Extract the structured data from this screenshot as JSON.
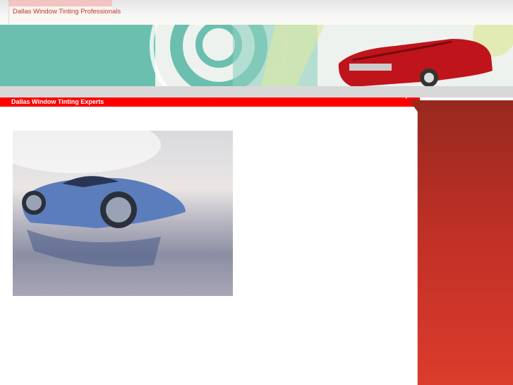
{
  "header": {
    "site_title": "Dallas Window Tinting Professionals"
  },
  "nav": {
    "tagline": "Dallas Window Tinting Experts"
  },
  "colors": {
    "accent": "#ff0000",
    "panel": "#c23026",
    "banner": "#6bbfae"
  }
}
